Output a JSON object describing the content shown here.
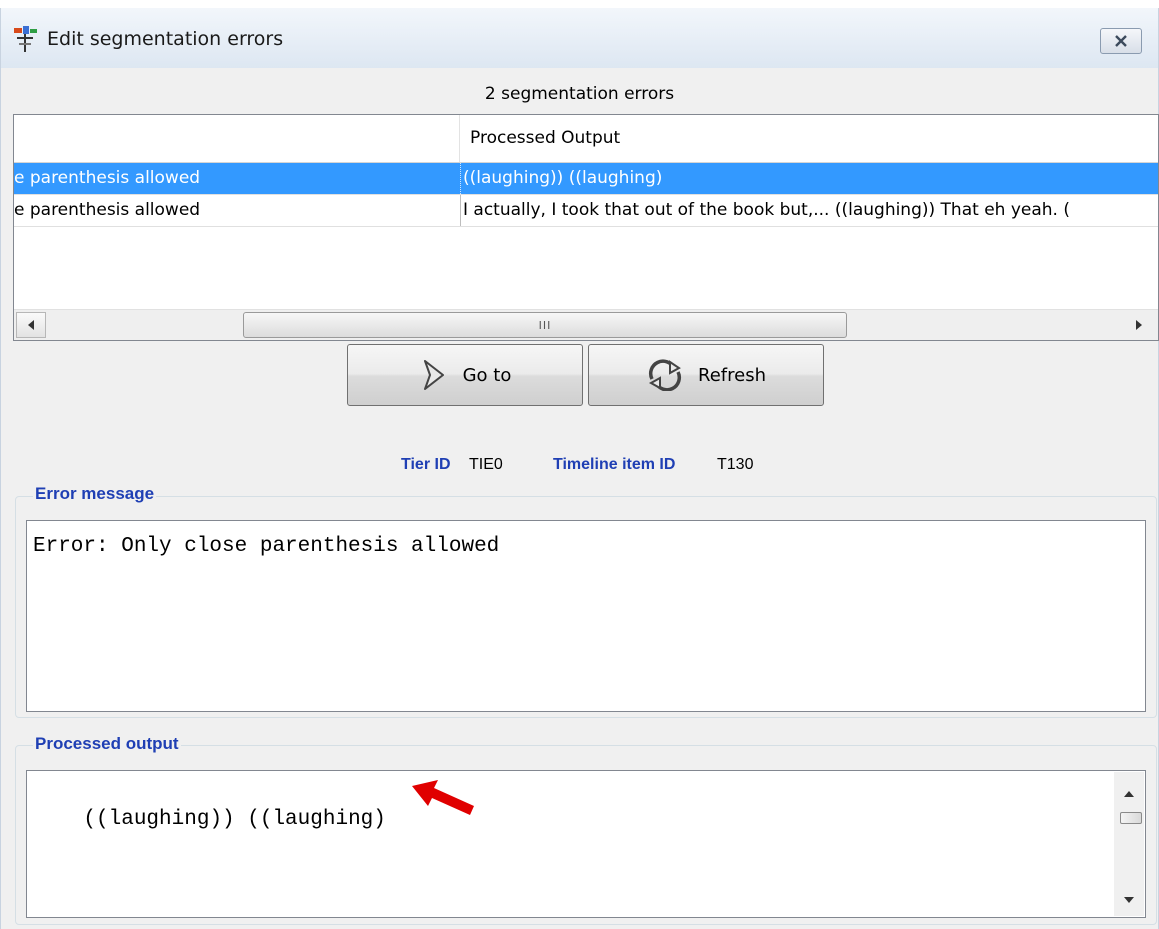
{
  "window": {
    "title": "Edit segmentation errors",
    "close_glyph": "☒"
  },
  "summary": {
    "text": "2 segmentation errors"
  },
  "table": {
    "columns": [
      "",
      "Processed Output"
    ],
    "rows": [
      {
        "error": "e parenthesis allowed",
        "output": "((laughing)) ((laughing)",
        "selected": true
      },
      {
        "error": "e parenthesis allowed",
        "output": "I actually, I took that out of the book but,... ((laughing)) That eh yeah. (",
        "selected": false
      }
    ],
    "scroll_thumb_glyph": "III"
  },
  "buttons": {
    "goto_label": "Go to",
    "refresh_label": "Refresh"
  },
  "ids": {
    "tier_label": "Tier ID",
    "tier_value": "TIE0",
    "timeline_label": "Timeline item ID",
    "timeline_value": "T130"
  },
  "error_message": {
    "title": "Error message",
    "text": "Error: Only close parenthesis allowed"
  },
  "processed_output": {
    "title": "Processed output",
    "text": "((laughing)) ((laughing)"
  },
  "colors": {
    "selection": "#3399ff",
    "group_title": "#1f3fb4",
    "annotation_arrow": "#e00000"
  }
}
